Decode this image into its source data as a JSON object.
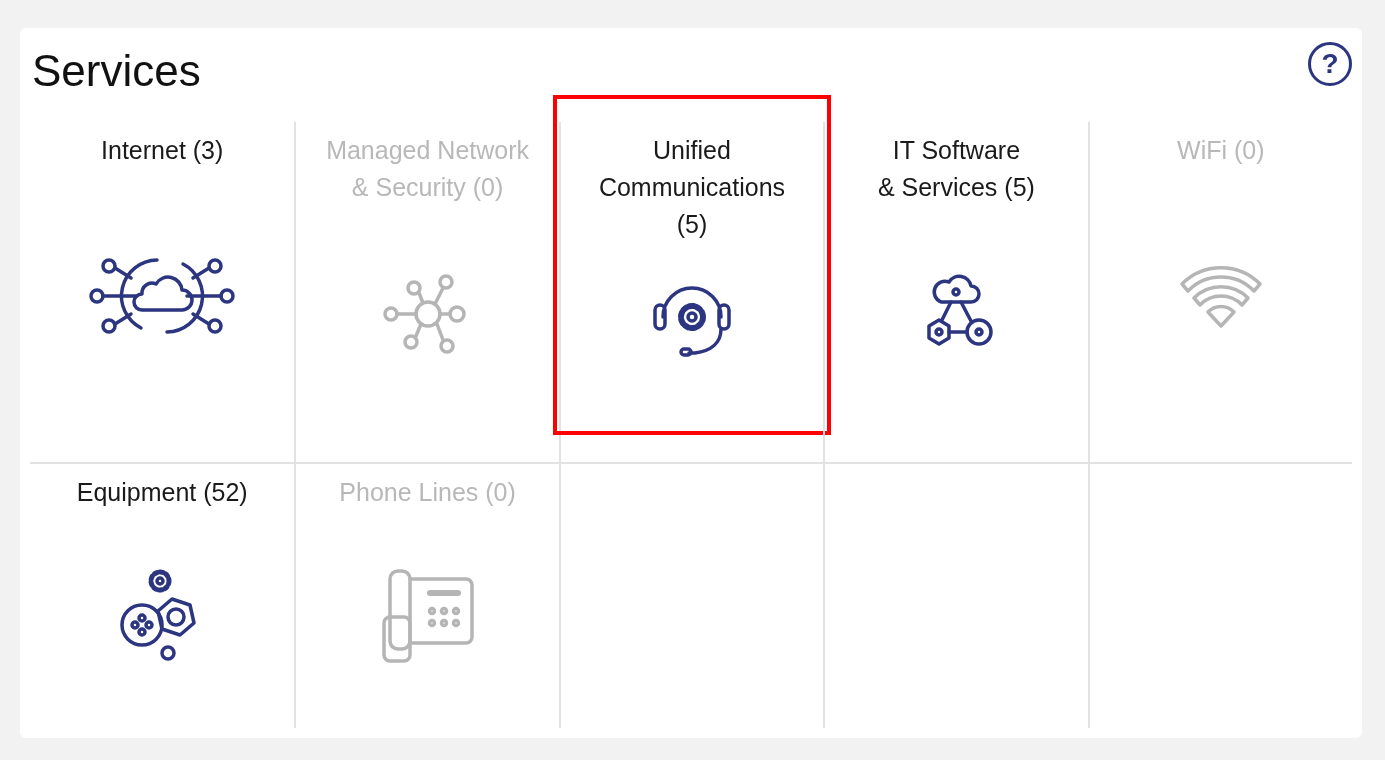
{
  "panel": {
    "title": "Services",
    "help": "?"
  },
  "tiles": [
    {
      "lines": [
        "Internet (3)"
      ],
      "disabled": false,
      "selected": false
    },
    {
      "lines": [
        "Managed Network",
        "& Security (0)"
      ],
      "disabled": true,
      "selected": false
    },
    {
      "lines": [
        "Unified",
        "Communications",
        "(5)"
      ],
      "disabled": false,
      "selected": true
    },
    {
      "lines": [
        "IT Software",
        "& Services (5)"
      ],
      "disabled": false,
      "selected": false
    },
    {
      "lines": [
        "WiFi (0)"
      ],
      "disabled": true,
      "selected": false
    },
    {
      "lines": [
        "Equipment (52)"
      ],
      "disabled": false,
      "selected": false
    },
    {
      "lines": [
        "Phone Lines (0)"
      ],
      "disabled": true,
      "selected": false
    }
  ]
}
